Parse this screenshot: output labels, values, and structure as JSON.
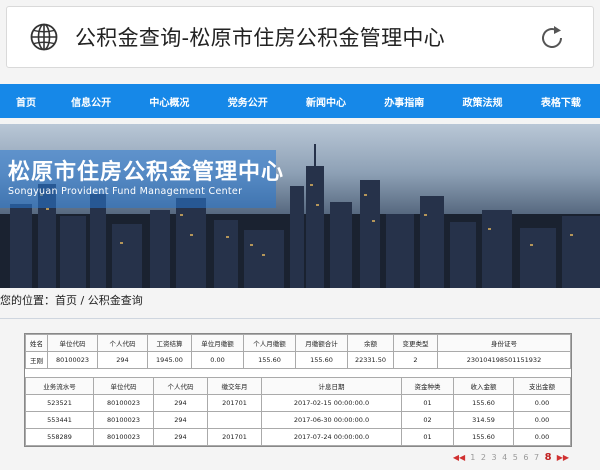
{
  "address_bar": {
    "title": "公积金查询-松原市住房公积金管理中心"
  },
  "nav": {
    "items": [
      "首页",
      "信息公开",
      "中心概况",
      "党务公开",
      "新闻中心",
      "办事指南",
      "政策法规",
      "表格下载"
    ]
  },
  "banner": {
    "title": "松原市住房公积金管理中心",
    "subtitle": "Songyuan Provident Fund Management Center"
  },
  "breadcrumb": {
    "text": "您的位置：首页 / 公积金查询"
  },
  "account_table": {
    "headers": [
      "姓名",
      "单位代码",
      "个人代码",
      "工资结算",
      "单位月缴额",
      "个人月缴额",
      "月缴额合计",
      "余额",
      "变更类型",
      "身份证号"
    ],
    "row": [
      "王刚",
      "80100023",
      "294",
      "1945.00",
      "0.00",
      "155.60",
      "155.60",
      "22331.50",
      "2",
      "230104198501151932"
    ]
  },
  "flow_table": {
    "headers": [
      "业务流水号",
      "单位代码",
      "个人代码",
      "缴交年月",
      "计息日期",
      "资金种类",
      "收入金额",
      "支出金额"
    ],
    "rows": [
      [
        "523521",
        "80100023",
        "294",
        "201701",
        "2017-02-15 00:00:00.0",
        "01",
        "155.60",
        "0.00"
      ],
      [
        "553441",
        "80100023",
        "294",
        "",
        "2017-06-30 00:00:00.0",
        "02",
        "314.59",
        "0.00"
      ],
      [
        "558289",
        "80100023",
        "294",
        "201701",
        "2017-07-24 00:00:00.0",
        "01",
        "155.60",
        "0.00"
      ]
    ]
  },
  "pager": {
    "first": "◀◀",
    "pages": [
      "1",
      "2",
      "3",
      "4",
      "5",
      "6",
      "7"
    ],
    "current": "8",
    "next": "▶▶"
  },
  "colors": {
    "nav": "#1688e8",
    "banner_box": "#2878d2",
    "pager_current": "#c02020"
  }
}
